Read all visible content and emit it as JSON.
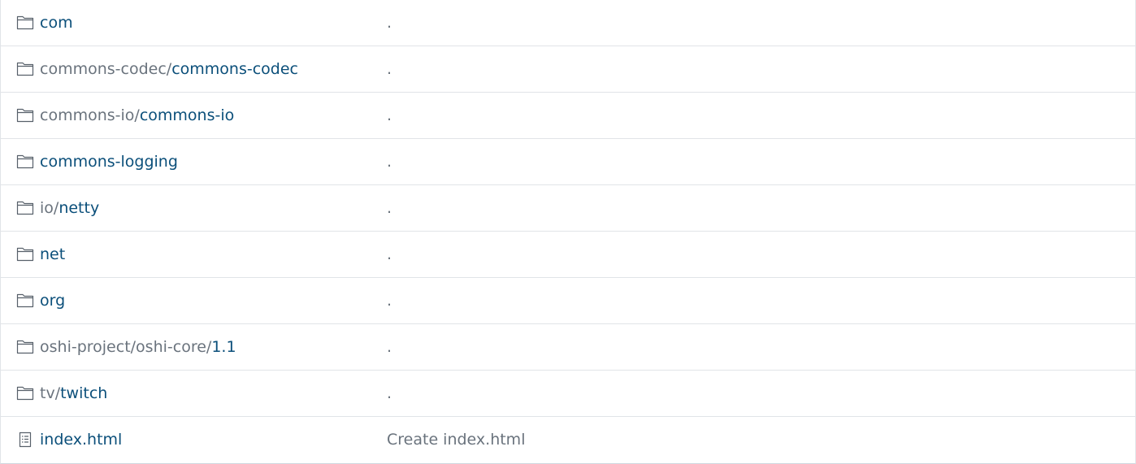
{
  "file_list": {
    "rows": [
      {
        "type": "folder",
        "icon": "folder-icon",
        "prefix": "",
        "name": "com",
        "message": "."
      },
      {
        "type": "folder",
        "icon": "folder-icon",
        "prefix": "commons-codec/",
        "name": "commons-codec",
        "message": "."
      },
      {
        "type": "folder",
        "icon": "folder-icon",
        "prefix": "commons-io/",
        "name": "commons-io",
        "message": "."
      },
      {
        "type": "folder",
        "icon": "folder-icon",
        "prefix": "",
        "name": "commons-logging",
        "message": "."
      },
      {
        "type": "folder",
        "icon": "folder-icon",
        "prefix": "io/",
        "name": "netty",
        "message": "."
      },
      {
        "type": "folder",
        "icon": "folder-icon",
        "prefix": "",
        "name": "net",
        "message": "."
      },
      {
        "type": "folder",
        "icon": "folder-icon",
        "prefix": "",
        "name": "org",
        "message": "."
      },
      {
        "type": "folder",
        "icon": "folder-icon",
        "prefix": "oshi-project/oshi-core/",
        "name": "1.1",
        "message": "."
      },
      {
        "type": "folder",
        "icon": "folder-icon",
        "prefix": "tv/",
        "name": "twitch",
        "message": "."
      },
      {
        "type": "file",
        "icon": "file-icon",
        "prefix": "",
        "name": "index.html",
        "message": "Create index.html"
      }
    ]
  },
  "colors": {
    "link": "#0b4f7a",
    "muted": "#6a737d",
    "border": "#e1e4e8"
  }
}
